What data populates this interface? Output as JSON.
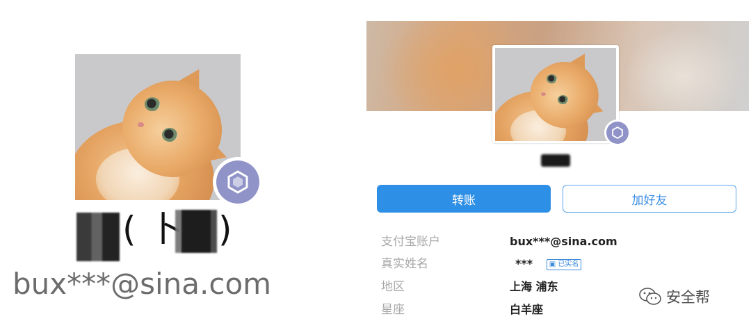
{
  "left_profile": {
    "name_parts": {
      "open_paren": "(",
      "middle_char": "卜",
      "close_paren": ")"
    },
    "email": "bux***@sina.com"
  },
  "right_profile": {
    "buttons": {
      "transfer": "转账",
      "add_friend": "加好友"
    },
    "info": [
      {
        "label": "支付宝账户",
        "value": "bux***@sina.com"
      },
      {
        "label": "真实姓名",
        "value": "***",
        "tag": "已实名"
      },
      {
        "label": "地区",
        "value": "上海 浦东"
      },
      {
        "label": "星座",
        "value": "白羊座"
      }
    ]
  },
  "watermark": {
    "text": "安全帮"
  },
  "colors": {
    "primary_button": "#2e8fe6",
    "badge": "#8f93c7",
    "label_gray": "#a8a8a8"
  }
}
